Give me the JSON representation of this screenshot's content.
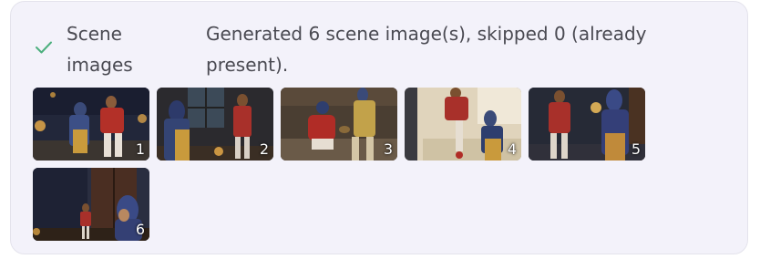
{
  "status": {
    "icon": "checkmark-icon",
    "label": "Scene images",
    "message": "Generated 6 scene image(s), skipped 0 (already present).",
    "success_color": "#4caf7d"
  },
  "scenes": [
    {
      "number": "1",
      "description": "couple-with-lantern-night"
    },
    {
      "number": "2",
      "description": "woman-and-soldier-by-window"
    },
    {
      "number": "3",
      "description": "soldier-crouching-with-villager"
    },
    {
      "number": "4",
      "description": "woman-and-man-on-sunlit-street"
    },
    {
      "number": "5",
      "description": "soldier-and-woman-with-lamp"
    },
    {
      "number": "6",
      "description": "woman-at-doorway-night"
    }
  ]
}
